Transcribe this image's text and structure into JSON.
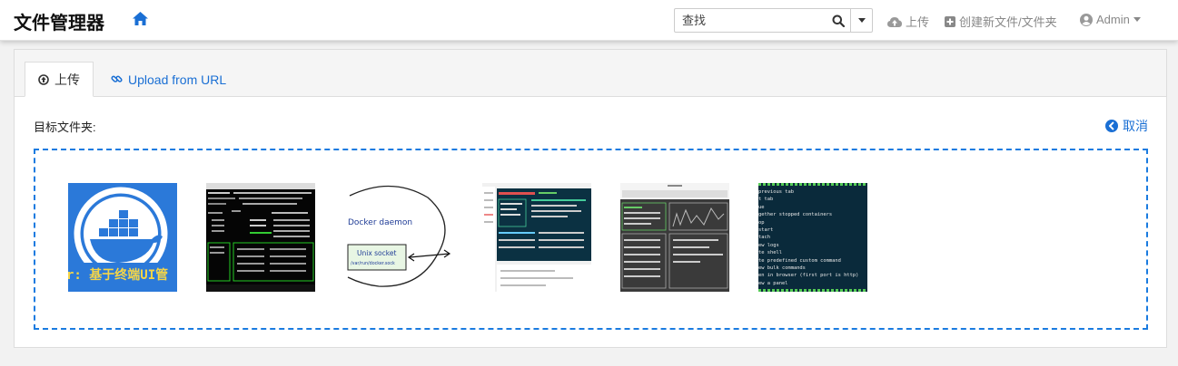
{
  "app": {
    "title": "文件管理器"
  },
  "search": {
    "placeholder": "查找"
  },
  "nav": {
    "upload_label": "上传",
    "create_label": "创建新文件/文件夹",
    "user_label": "Admin"
  },
  "tabs": {
    "upload_label": "上传",
    "url_label": "Upload from URL"
  },
  "upload": {
    "target_label": "目标文件夹:",
    "cancel_label": "取消"
  },
  "thumbnails": {
    "docker_caption": "r: 基于终端UI管",
    "daemon_label": "Docker daemon",
    "socket_label": "Unix socket",
    "socket_sub": "/var/run/docker.sock",
    "terminal_lines": [
      "previous tab",
      "t tab",
      "ue",
      "gether stopped containers",
      "op",
      "start",
      "tach",
      "ew logs",
      "te shell",
      "te predefined custom command",
      "ew bulk commands",
      "en in browser (first port is http)",
      "ew a panel"
    ]
  },
  "colors": {
    "accent": "#1a6fd4",
    "dropzone_border": "#1a7be0",
    "docker_blue": "#2b79d9"
  }
}
